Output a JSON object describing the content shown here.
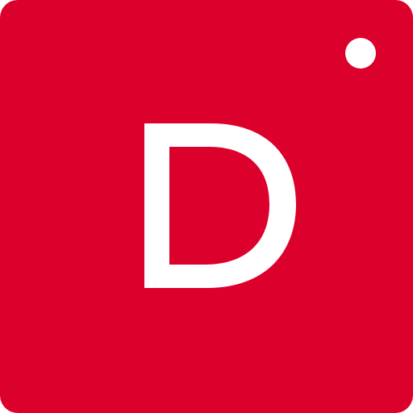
{
  "logo": {
    "letter": "D",
    "background_color": "#dc002c",
    "foreground_color": "#ffffff"
  }
}
